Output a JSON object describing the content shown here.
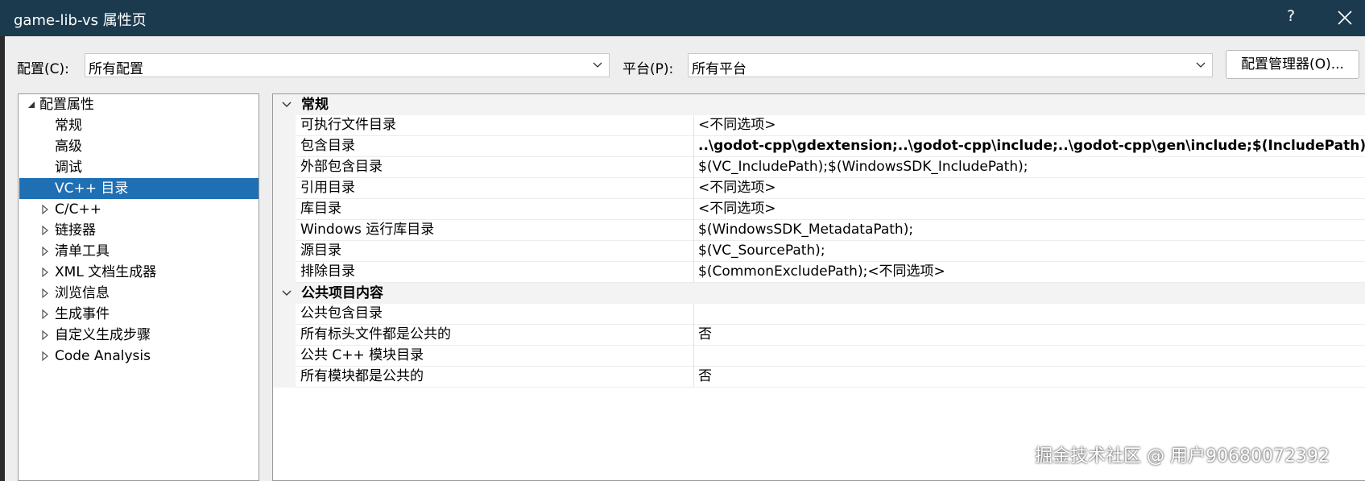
{
  "window": {
    "title": "game-lib-vs 属性页",
    "help_label": "?",
    "close_icon": "close-icon"
  },
  "config_row": {
    "config_label": "配置(C):",
    "config_value": "所有配置",
    "platform_label": "平台(P):",
    "platform_value": "所有平台",
    "manager_button": "配置管理器(O)..."
  },
  "tree": {
    "items": [
      {
        "label": "配置属性",
        "level": 0,
        "expander": "expanded"
      },
      {
        "label": "常规",
        "level": 1,
        "expander": "none"
      },
      {
        "label": "高级",
        "level": 1,
        "expander": "none"
      },
      {
        "label": "调试",
        "level": 1,
        "expander": "none"
      },
      {
        "label": "VC++ 目录",
        "level": 1,
        "expander": "none",
        "selected": true
      },
      {
        "label": "C/C++",
        "level": 1,
        "expander": "collapsed"
      },
      {
        "label": "链接器",
        "level": 1,
        "expander": "collapsed"
      },
      {
        "label": "清单工具",
        "level": 1,
        "expander": "collapsed"
      },
      {
        "label": "XML 文档生成器",
        "level": 1,
        "expander": "collapsed"
      },
      {
        "label": "浏览信息",
        "level": 1,
        "expander": "collapsed"
      },
      {
        "label": "生成事件",
        "level": 1,
        "expander": "collapsed"
      },
      {
        "label": "自定义生成步骤",
        "level": 1,
        "expander": "collapsed"
      },
      {
        "label": "Code Analysis",
        "level": 1,
        "expander": "collapsed"
      }
    ]
  },
  "grid": {
    "categories": [
      {
        "title": "常规",
        "rows": [
          {
            "name": "可执行文件目录",
            "value": "<不同选项>",
            "bold": false
          },
          {
            "name": "包含目录",
            "value": "..\\godot-cpp\\gdextension;..\\godot-cpp\\include;..\\godot-cpp\\gen\\include;$(IncludePath)",
            "bold": true
          },
          {
            "name": "外部包含目录",
            "value": "$(VC_IncludePath);$(WindowsSDK_IncludePath);",
            "bold": false
          },
          {
            "name": "引用目录",
            "value": "<不同选项>",
            "bold": false
          },
          {
            "name": "库目录",
            "value": "<不同选项>",
            "bold": false
          },
          {
            "name": "Windows 运行库目录",
            "value": "$(WindowsSDK_MetadataPath);",
            "bold": false
          },
          {
            "name": "源目录",
            "value": "$(VC_SourcePath);",
            "bold": false
          },
          {
            "name": "排除目录",
            "value": "$(CommonExcludePath);<不同选项>",
            "bold": false
          }
        ]
      },
      {
        "title": "公共项目内容",
        "rows": [
          {
            "name": "公共包含目录",
            "value": "",
            "bold": false
          },
          {
            "name": "所有标头文件都是公共的",
            "value": "否",
            "bold": false
          },
          {
            "name": "公共 C++ 模块目录",
            "value": "",
            "bold": false
          },
          {
            "name": "所有模块都是公共的",
            "value": "否",
            "bold": false
          }
        ]
      }
    ]
  },
  "watermark": "掘金技术社区 @ 用户90680072392",
  "colors": {
    "titlebar": "#1c3a4e",
    "selection": "#1f6fb5",
    "dialog_bg": "#eeeeee"
  }
}
